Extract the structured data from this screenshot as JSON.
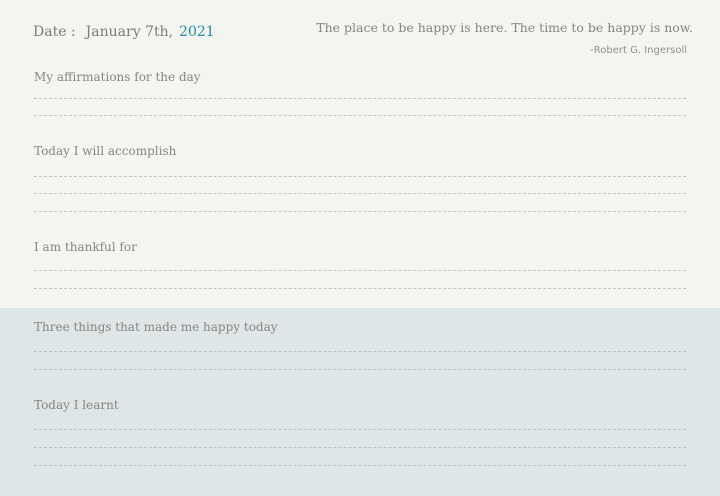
{
  "header": {
    "date_label": "Date :",
    "date_text": "January 7th,",
    "year": "2021"
  },
  "quote": {
    "text": "The place to be happy is here. The time to be happy is now.",
    "author": "-Robert G. Ingersoll"
  },
  "sections": [
    {
      "label": "My affirmations for the day"
    },
    {
      "label": "Today I will accomplish"
    },
    {
      "label": "I am thankful for"
    },
    {
      "label": "Three things that made me happy today"
    },
    {
      "label": "Today I learnt"
    }
  ]
}
